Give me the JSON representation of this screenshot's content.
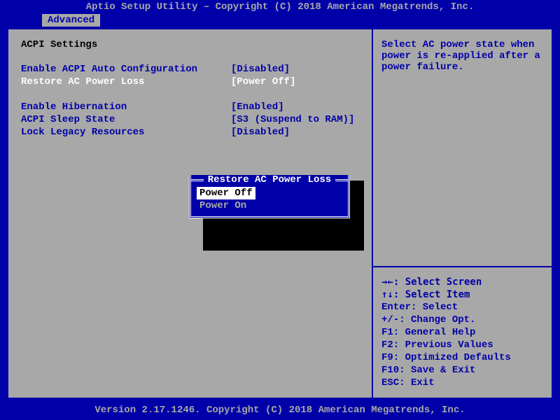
{
  "title": "Aptio Setup Utility – Copyright (C) 2018 American Megatrends, Inc.",
  "tab": "Advanced",
  "section": "ACPI Settings",
  "settings": {
    "auto_cfg": {
      "label": "Enable ACPI Auto Configuration",
      "value": "[Disabled]"
    },
    "restore_ac": {
      "label": "Restore AC Power Loss",
      "value": "[Power Off]"
    },
    "hibernate": {
      "label": "Enable Hibernation",
      "value": "[Enabled]"
    },
    "sleep_state": {
      "label": "ACPI Sleep State",
      "value": "[S3 (Suspend to RAM)]"
    },
    "lock_legacy": {
      "label": "Lock Legacy Resources",
      "value": "[Disabled]"
    }
  },
  "help_text": "Select AC power state when power is re-applied after a power failure.",
  "keyhints": {
    "l1": "→←: Select Screen",
    "l2": "↑↓: Select Item",
    "l3": "Enter: Select",
    "l4": "+/-: Change Opt.",
    "l5": "F1: General Help",
    "l6": "F2: Previous Values",
    "l7": "F9: Optimized Defaults",
    "l8": "F10: Save & Exit",
    "l9": "ESC: Exit"
  },
  "popup": {
    "title": "Restore AC Power Loss",
    "opt1": "Power Off",
    "opt2": "Power On"
  },
  "footer": "Version 2.17.1246. Copyright (C) 2018 American Megatrends, Inc."
}
